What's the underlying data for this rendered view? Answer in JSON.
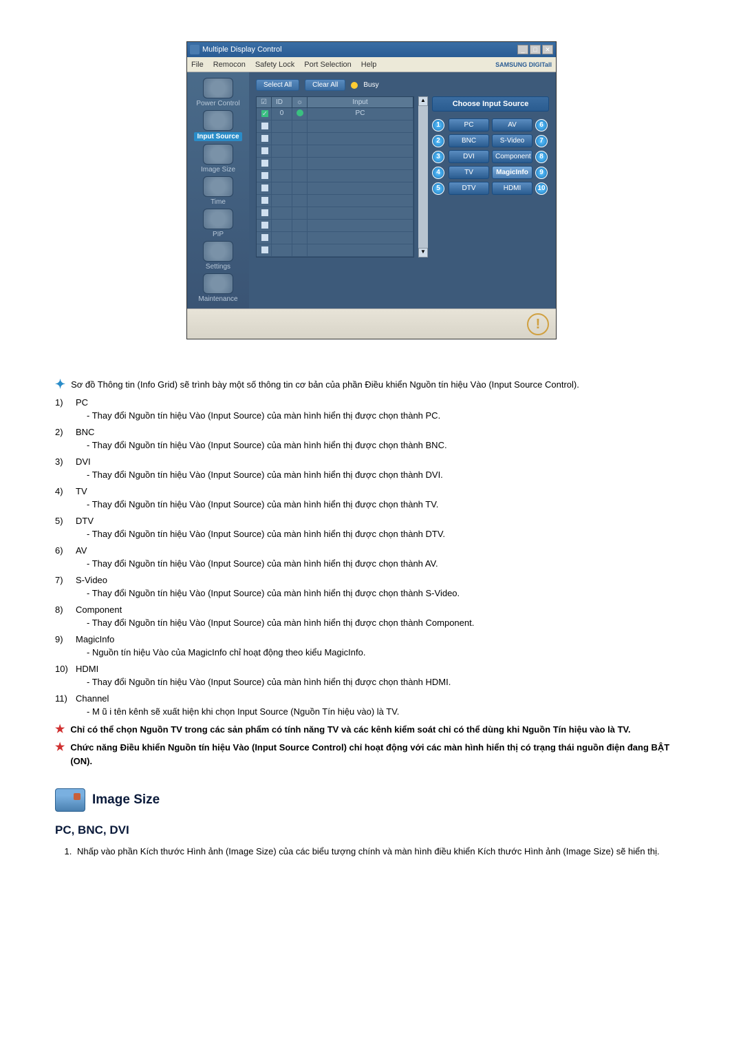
{
  "window": {
    "title": "Multiple Display Control",
    "controls": {
      "min": "_",
      "max": "□",
      "close": "✕"
    }
  },
  "menubar": {
    "items": [
      "File",
      "Remocon",
      "Safety Lock",
      "Port Selection",
      "Help"
    ],
    "brand": "SAMSUNG DIGITall"
  },
  "sidebar": {
    "items": [
      {
        "label": "Power Control",
        "active": false
      },
      {
        "label": "Input Source",
        "active": true
      },
      {
        "label": "Image Size",
        "active": false
      },
      {
        "label": "Time",
        "active": false
      },
      {
        "label": "PIP",
        "active": false
      },
      {
        "label": "Settings",
        "active": false
      },
      {
        "label": "Maintenance",
        "active": false
      }
    ]
  },
  "toolbar": {
    "select_all": "Select All",
    "clear_all": "Clear All",
    "busy_label": "Busy"
  },
  "grid": {
    "headers": {
      "chk": "☑",
      "id": "ID",
      "pic": "☼",
      "input": "Input"
    },
    "rows": [
      {
        "chk": "☑",
        "id": "0",
        "pic": "●",
        "input": "PC"
      },
      {
        "chk": "□",
        "id": "",
        "pic": "",
        "input": ""
      },
      {
        "chk": "□",
        "id": "",
        "pic": "",
        "input": ""
      },
      {
        "chk": "□",
        "id": "",
        "pic": "",
        "input": ""
      },
      {
        "chk": "□",
        "id": "",
        "pic": "",
        "input": ""
      },
      {
        "chk": "□",
        "id": "",
        "pic": "",
        "input": ""
      },
      {
        "chk": "□",
        "id": "",
        "pic": "",
        "input": ""
      },
      {
        "chk": "□",
        "id": "",
        "pic": "",
        "input": ""
      },
      {
        "chk": "□",
        "id": "",
        "pic": "",
        "input": ""
      },
      {
        "chk": "□",
        "id": "",
        "pic": "",
        "input": ""
      },
      {
        "chk": "□",
        "id": "",
        "pic": "",
        "input": ""
      },
      {
        "chk": "□",
        "id": "",
        "pic": "",
        "input": ""
      }
    ]
  },
  "source_panel": {
    "header": "Choose Input Source",
    "left": [
      {
        "num": "1",
        "label": "PC"
      },
      {
        "num": "2",
        "label": "BNC"
      },
      {
        "num": "3",
        "label": "DVI"
      },
      {
        "num": "4",
        "label": "TV"
      },
      {
        "num": "5",
        "label": "DTV"
      }
    ],
    "right": [
      {
        "num": "6",
        "label": "AV"
      },
      {
        "num": "7",
        "label": "S-Video"
      },
      {
        "num": "8",
        "label": "Component"
      },
      {
        "num": "9",
        "label": "MagicInfo"
      },
      {
        "num": "10",
        "label": "HDMI"
      }
    ]
  },
  "status": {
    "icon_text": "!"
  },
  "doc": {
    "intro": "Sơ đồ Thông tin (Info Grid) sẽ trình bày một số thông tin cơ bản của phần Điều khiển Nguồn tín hiệu Vào (Input Source Control).",
    "items": [
      {
        "num": "1)",
        "title": "PC",
        "desc": "- Thay đổi Nguồn tín hiệu Vào (Input Source) của màn hình hiển thị được chọn thành PC."
      },
      {
        "num": "2)",
        "title": "BNC",
        "desc": "- Thay đổi Nguồn tín hiệu Vào (Input Source) của màn hình hiển thị được chọn thành BNC."
      },
      {
        "num": "3)",
        "title": "DVI",
        "desc": "- Thay đổi Nguồn tín hiệu Vào (Input Source) của màn hình hiển thị được chọn thành DVI."
      },
      {
        "num": "4)",
        "title": "TV",
        "desc": "- Thay đổi Nguồn tín hiệu Vào (Input Source) của màn hình hiển thị được chọn thành TV."
      },
      {
        "num": "5)",
        "title": "DTV",
        "desc": "- Thay đổi Nguồn tín hiệu Vào (Input Source) của màn hình hiển thị được chọn thành DTV."
      },
      {
        "num": "6)",
        "title": "AV",
        "desc": "- Thay đổi Nguồn tín hiệu Vào (Input Source) của màn hình hiển thị được chọn thành AV."
      },
      {
        "num": "7)",
        "title": "S-Video",
        "desc": "- Thay đổi Nguồn tín hiệu Vào (Input Source) của màn hình hiển thị được chọn thành S-Video."
      },
      {
        "num": "8)",
        "title": "Component",
        "desc": "- Thay đổi Nguồn tín hiệu Vào (Input Source) của màn hình hiển thị được chọn thành Component."
      },
      {
        "num": "9)",
        "title": "MagicInfo",
        "desc": "- Nguồn tín hiệu Vào của MagicInfo chỉ hoạt động theo kiểu MagicInfo."
      },
      {
        "num": "10)",
        "title": "HDMI",
        "desc": "- Thay đổi Nguồn tín hiệu Vào (Input Source) của màn hình hiển thị được chọn thành HDMI."
      },
      {
        "num": "11)",
        "title": "Channel",
        "desc": "- M ũ i tên kênh sẽ xuất hiện khi chọn Input Source (Nguồn Tín hiệu vào) là TV."
      }
    ],
    "notes": [
      "Chỉ có thể chọn Nguồn TV trong các sản phẩm có tính năng TV và các kênh kiểm soát chỉ có thể dùng khi Nguồn Tín hiệu vào là TV.",
      "Chức năng Điều khiển Nguồn tín hiệu Vào (Input Source Control) chỉ hoạt động với các màn hình hiển thị có trạng thái nguồn điện đang BẬT (ON)."
    ],
    "section_title": "Image Size",
    "subheading": "PC, BNC, DVI",
    "ordered": [
      "Nhấp vào phần Kích thước Hình ảnh (Image Size) của các biểu tượng chính và màn hình điều khiển Kích thước Hình ảnh (Image Size) sẽ hiển thị."
    ]
  }
}
